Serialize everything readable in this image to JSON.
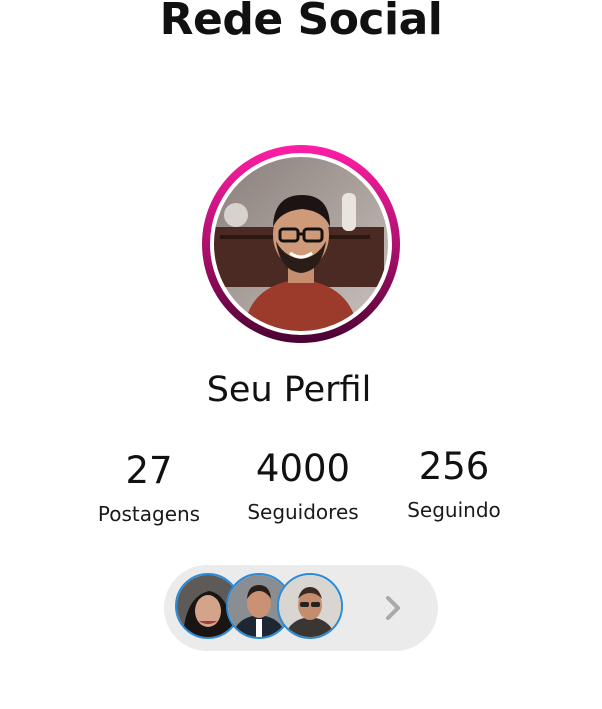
{
  "header": {
    "title": "Rede Social"
  },
  "profile": {
    "name": "Seu Perfil",
    "avatar_icon": "profile-photo",
    "ring_colors": [
      "#ff1ea6",
      "#b0106f",
      "#4a0231"
    ]
  },
  "stats": [
    {
      "value": "27",
      "label": "Postagens"
    },
    {
      "value": "4000",
      "label": "Seguidores"
    },
    {
      "value": "256",
      "label": "Seguindo"
    }
  ],
  "followers_preview": {
    "avatars": [
      "follower-avatar-1",
      "follower-avatar-2",
      "follower-avatar-3"
    ],
    "border_color": "#2a8bd8",
    "more_icon": "chevron-right-icon"
  }
}
